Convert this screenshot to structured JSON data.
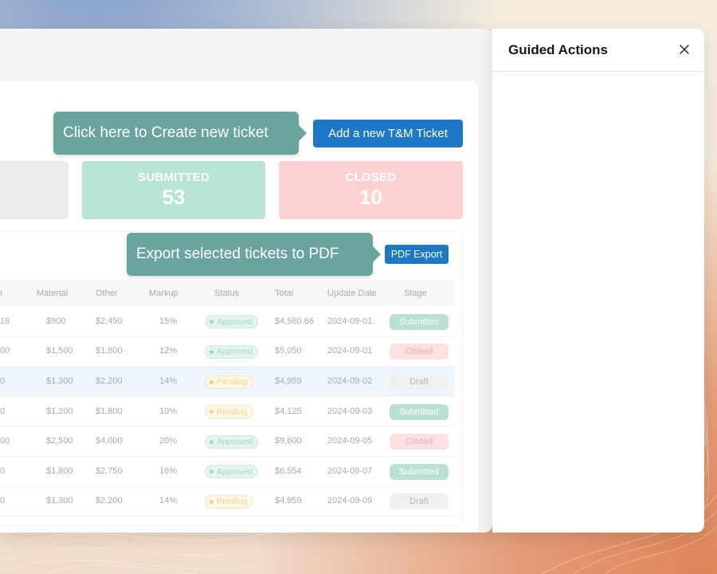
{
  "app": {
    "create_tooltip": "Click here to Create new ticket",
    "add_ticket_label": "Add a new T&M Ticket",
    "export_tooltip": "Export selected tickets to PDF",
    "pdf_export_label": "PDF Export"
  },
  "stats": {
    "submitted": {
      "label": "SUBMITTED",
      "value": "53"
    },
    "closed": {
      "label": "CLOSED",
      "value": "10"
    }
  },
  "table": {
    "columns": {
      "partial": "r",
      "material": "Material",
      "other": "Other",
      "markup": "Markup",
      "status": "Status",
      "total": "Total",
      "update_date": "Update Date",
      "stage": "Stage"
    },
    "rows": [
      {
        "partial": "18",
        "material": "$900",
        "other": "$2,450",
        "markup": "15%",
        "status": "Approved",
        "total": "$4,580.66",
        "update_date": "2024-09-01",
        "stage": "Submitted",
        "highlighted": false
      },
      {
        "partial": "00",
        "material": "$1,500",
        "other": "$1,800",
        "markup": "12%",
        "status": "Approved",
        "total": "$5,050",
        "update_date": "2024-09-01",
        "stage": "Closed",
        "highlighted": false
      },
      {
        "partial": "0",
        "material": "$1,300",
        "other": "$2,200",
        "markup": "14%",
        "status": "Pending",
        "total": "$4,959",
        "update_date": "2024-09-02",
        "stage": "Draft",
        "highlighted": true
      },
      {
        "partial": "0",
        "material": "$1,200",
        "other": "$1,800",
        "markup": "10%",
        "status": "Pending",
        "total": "$4,125",
        "update_date": "2024-09-03",
        "stage": "Submitted",
        "highlighted": false
      },
      {
        "partial": "00",
        "material": "$2,500",
        "other": "$4,000",
        "markup": "20%",
        "status": "Approved",
        "total": "$9,600",
        "update_date": "2024-09-05",
        "stage": "Closed",
        "highlighted": false
      },
      {
        "partial": "0",
        "material": "$1,800",
        "other": "$2,750",
        "markup": "16%",
        "status": "Approved",
        "total": "$6,554",
        "update_date": "2024-09-07",
        "stage": "Submitted",
        "highlighted": false
      },
      {
        "partial": "0",
        "material": "$1,300",
        "other": "$2,200",
        "markup": "14%",
        "status": "Pending",
        "total": "$4,959",
        "update_date": "2024-09-09",
        "stage": "Draft",
        "highlighted": false
      }
    ]
  },
  "guided": {
    "title": "Guided Actions",
    "close_icon": "close-icon"
  },
  "colors": {
    "primary_button": "#1e78c6",
    "tooltip": "#6ba39e",
    "submitted_card": "#b7e4d6",
    "closed_card": "#fdd1d1"
  }
}
